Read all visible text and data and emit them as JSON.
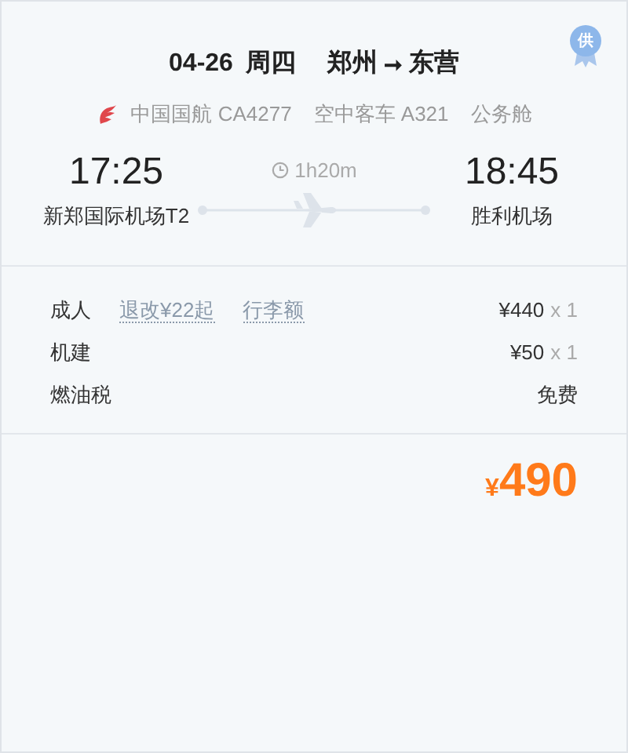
{
  "header": {
    "date": "04-26",
    "weekday": "周四",
    "from": "郑州",
    "arrow": "➞",
    "to": "东营",
    "badge": "供"
  },
  "flight": {
    "airline": "中国国航 CA4277",
    "aircraft": "空中客车 A321",
    "cabin": "公务舱"
  },
  "departure": {
    "time": "17:25",
    "airport": "新郑国际机场T2"
  },
  "duration": "1h20m",
  "arrival": {
    "time": "18:45",
    "airport": "胜利机场"
  },
  "fares": [
    {
      "label": "成人",
      "links": [
        "退改¥22起",
        "行李额"
      ],
      "price": "¥440",
      "qty": "x 1"
    },
    {
      "label": "机建",
      "price": "¥50",
      "qty": "x 1"
    },
    {
      "label": "燃油税",
      "price": "免费"
    }
  ],
  "total": {
    "currency": "¥",
    "amount": "490"
  }
}
